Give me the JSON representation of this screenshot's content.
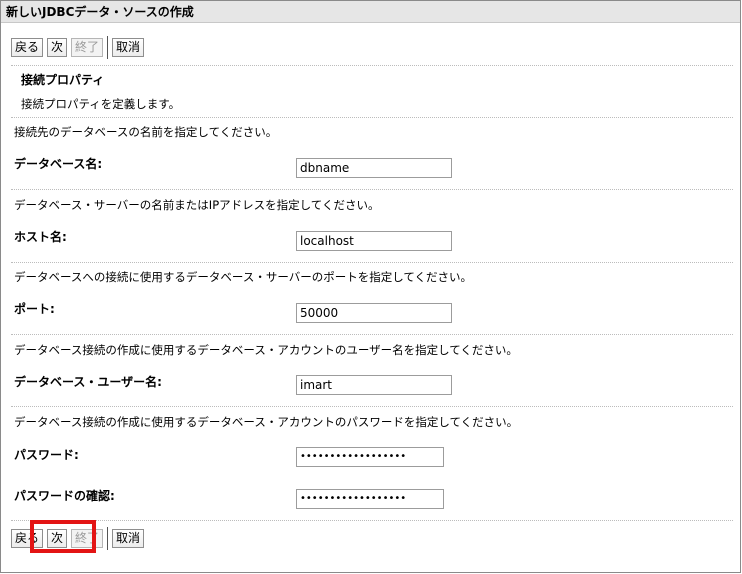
{
  "window": {
    "title": "新しいJDBCデータ・ソースの作成"
  },
  "buttons": {
    "back": "戻る",
    "next": "次",
    "finish": "終了",
    "cancel": "取消"
  },
  "section": {
    "title": "接続プロパティ",
    "description": "接続プロパティを定義します。"
  },
  "fields": {
    "database_name": {
      "help": "接続先のデータベースの名前を指定してください。",
      "label": "データベース名:",
      "value": "dbname"
    },
    "host_name": {
      "help": "データベース・サーバーの名前またはIPアドレスを指定してください。",
      "label": "ホスト名:",
      "value": "localhost"
    },
    "port": {
      "help": "データベースへの接続に使用するデータベース・サーバーのポートを指定してください。",
      "label": "ポート:",
      "value": "50000"
    },
    "db_user": {
      "help": "データベース接続の作成に使用するデータベース・アカウントのユーザー名を指定してください。",
      "label": "データベース・ユーザー名:",
      "value": "imart"
    },
    "password": {
      "help": "データベース接続の作成に使用するデータベース・アカウントのパスワードを指定してください。",
      "label": "パスワード:",
      "value": "••••••••••••••••••"
    },
    "password_confirm": {
      "label": "パスワードの確認:",
      "value": "••••••••••••••••••"
    }
  },
  "colors": {
    "highlight": "#e31414"
  }
}
